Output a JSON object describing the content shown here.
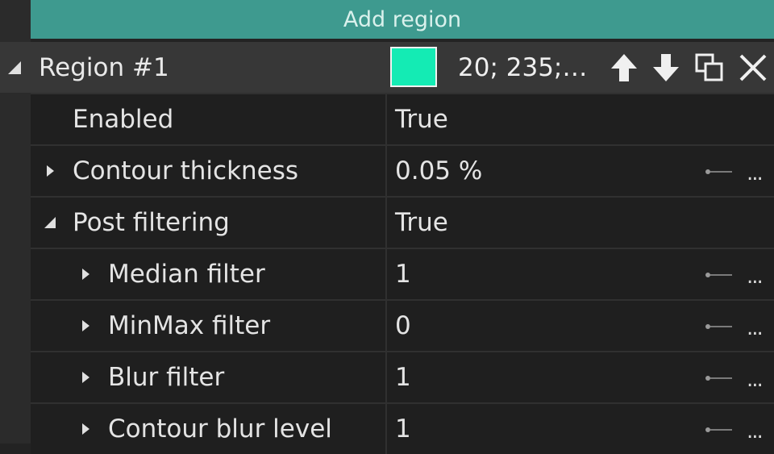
{
  "toolbar": {
    "add_region_label": "Add region"
  },
  "region": {
    "title": "Region #1",
    "color_hex": "#14ebb4",
    "rgb_text": "20; 235;…"
  },
  "properties": [
    {
      "label": "Enabled",
      "value": "True",
      "indent": 0,
      "expander": "none",
      "has_slider": false
    },
    {
      "label": "Contour thickness",
      "value": "0.05 %",
      "indent": 0,
      "expander": "collapsed",
      "has_slider": true
    },
    {
      "label": "Post filtering",
      "value": "True",
      "indent": 0,
      "expander": "expanded",
      "has_slider": false
    },
    {
      "label": "Median filter",
      "value": "1",
      "indent": 1,
      "expander": "collapsed",
      "has_slider": true
    },
    {
      "label": "MinMax filter",
      "value": "0",
      "indent": 1,
      "expander": "collapsed",
      "has_slider": true
    },
    {
      "label": "Blur filter",
      "value": "1",
      "indent": 1,
      "expander": "collapsed",
      "has_slider": true
    },
    {
      "label": "Contour blur level",
      "value": "1",
      "indent": 1,
      "expander": "collapsed",
      "has_slider": true
    }
  ],
  "ui": {
    "more_glyph": "..."
  }
}
